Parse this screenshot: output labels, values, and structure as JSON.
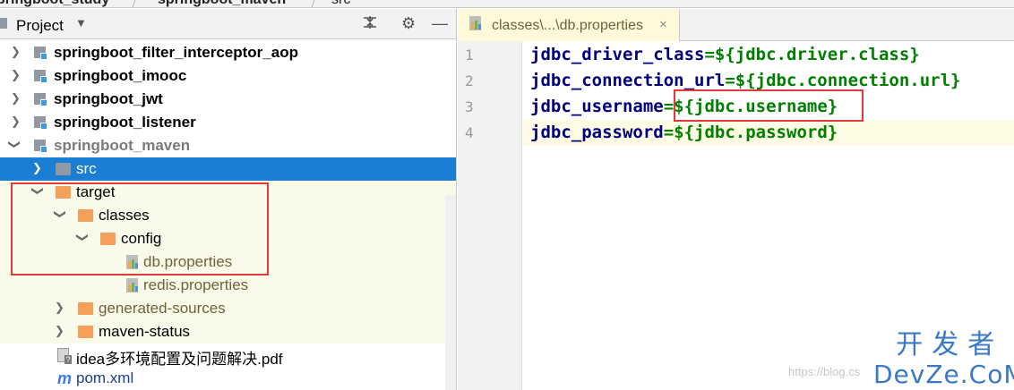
{
  "breadcrumbs": [
    "pringboot_study",
    "springboot_maven",
    "src"
  ],
  "project_panel": {
    "title": "Project",
    "icons": [
      "dropdown-icon",
      "collapse-icon",
      "gear-icon",
      "minimize-icon"
    ]
  },
  "tree": [
    {
      "label": "springboot_filter_interceptor_aop",
      "type": "module"
    },
    {
      "label": "springboot_imooc",
      "type": "module"
    },
    {
      "label": "springboot_jwt",
      "type": "module"
    },
    {
      "label": "springboot_listener",
      "type": "module"
    },
    {
      "label": "springboot_maven",
      "type": "module"
    },
    {
      "label": "src",
      "type": "folder"
    },
    {
      "label": "target",
      "type": "folder"
    },
    {
      "label": "classes",
      "type": "folder"
    },
    {
      "label": "config",
      "type": "folder"
    },
    {
      "label": "db.properties",
      "type": "properties"
    },
    {
      "label": "redis.properties",
      "type": "properties"
    },
    {
      "label": "generated-sources",
      "type": "folder"
    },
    {
      "label": "maven-status",
      "type": "folder"
    },
    {
      "label": "idea多环境配置及问题解决.pdf",
      "type": "pdf"
    },
    {
      "label": "pom.xml",
      "type": "maven"
    }
  ],
  "editor": {
    "tab_label": "classes\\...\\db.properties",
    "tab_close": "×",
    "lines": [
      {
        "num": "1",
        "key": "jdbc_driver_class",
        "eq": "=",
        "val": "${jdbc.driver.class}"
      },
      {
        "num": "2",
        "key": "jdbc_connection_url",
        "eq": "=",
        "val": "${jdbc.connection.url}"
      },
      {
        "num": "3",
        "key": "jdbc_username",
        "eq": "=",
        "val": "${jdbc.username}"
      },
      {
        "num": "4",
        "key": "jdbc_password",
        "eq": "=",
        "val": "${jdbc.password}"
      }
    ]
  },
  "watermark": {
    "cn": "开发者",
    "en": "DevZe.CoM",
    "url": "https://blog.cs"
  },
  "colors": {
    "selection": "#1a7ed3",
    "highlight_box": "#e23a3a",
    "key": "#00007f",
    "value": "#008000"
  }
}
